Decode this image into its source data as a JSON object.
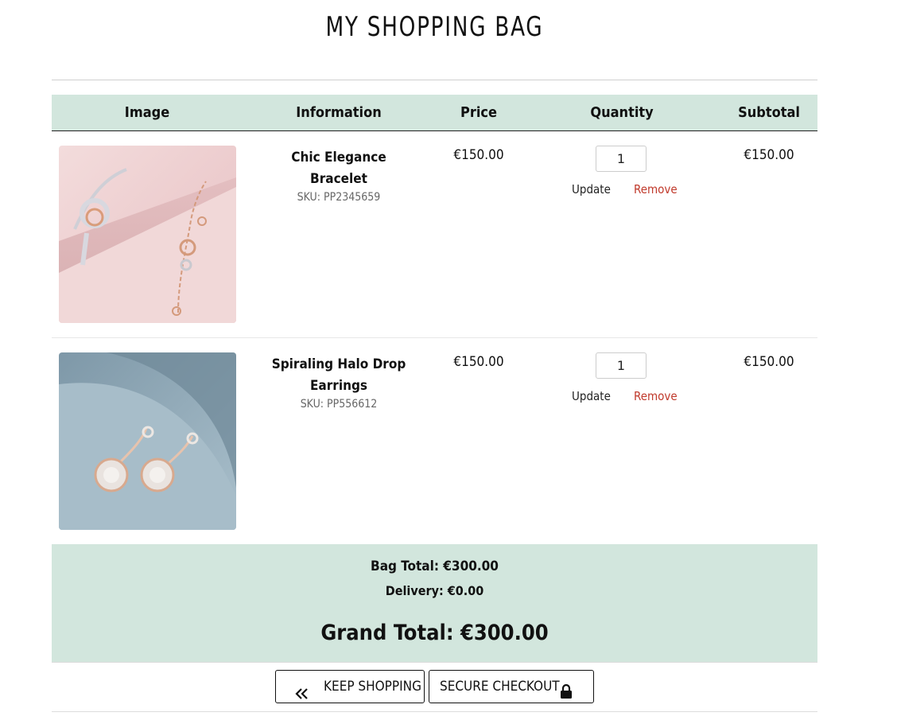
{
  "page": {
    "title": "MY SHOPPING BAG"
  },
  "table": {
    "headers": [
      "Image",
      "Information",
      "Price",
      "Quantity",
      "Subtotal"
    ]
  },
  "items": [
    {
      "name": "Chic Elegance Bracelet",
      "sku_label": "SKU:",
      "sku": "PP2345659",
      "price": "€150.00",
      "quantity": "1",
      "update_label": "Update",
      "remove_label": "Remove",
      "subtotal": "€150.00",
      "image_icon": "bracelet-photo"
    },
    {
      "name": "Spiraling Halo Drop Earrings",
      "sku_label": "SKU:",
      "sku": "PP556612",
      "price": "€150.00",
      "quantity": "1",
      "update_label": "Update",
      "remove_label": "Remove",
      "subtotal": "€150.00",
      "image_icon": "earrings-photo"
    }
  ],
  "totals": {
    "bag_total": "Bag Total: €300.00",
    "delivery": "Delivery: €0.00",
    "grand_total": "Grand Total: €300.00"
  },
  "actions": {
    "keep_shopping": "KEEP SHOPPING",
    "keep_shopping_icon": "double-chevron-left-icon",
    "secure_checkout": "SECURE CHECKOUT",
    "secure_checkout_icon": "lock-icon"
  },
  "colors": {
    "header_bg": "#d2e6dd",
    "remove_link": "#c0392b"
  }
}
